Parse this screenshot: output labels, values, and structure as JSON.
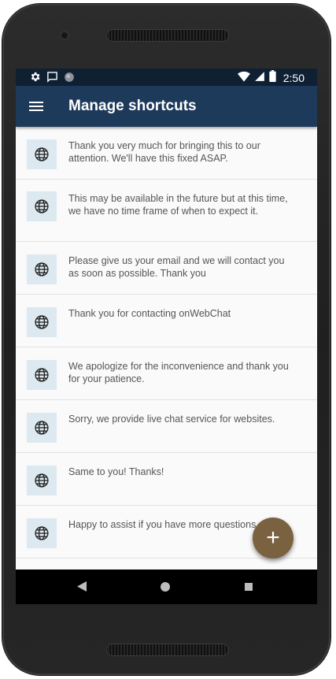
{
  "status_bar": {
    "time": "2:50",
    "left_icons": [
      "gear-icon",
      "message-icon",
      "circle-icon"
    ],
    "right_icons": [
      "wifi-icon",
      "signal-icon",
      "battery-icon"
    ]
  },
  "app_bar": {
    "menu_icon": "hamburger-menu-icon",
    "title": "Manage shortcuts"
  },
  "shortcuts": [
    {
      "text": "Thank you very much for bringing this to our attention. We'll have this fixed ASAP.",
      "icon": "globe-icon"
    },
    {
      "text": "This may be available in the future but at this time, we have no time frame of when to expect it.",
      "icon": "globe-icon"
    },
    {
      "text": "Please give us your email and we will contact you as soon as possible. Thank you",
      "icon": "globe-icon"
    },
    {
      "text": "Thank you for contacting onWebChat",
      "icon": "globe-icon"
    },
    {
      "text": "We apologize for the inconvenience and thank you for your patience.",
      "icon": "globe-icon"
    },
    {
      "text": "Sorry, we provide live chat service for websites.",
      "icon": "globe-icon"
    },
    {
      "text": "Same to you! Thanks!",
      "icon": "globe-icon"
    },
    {
      "text": "Happy to assist if you have more questions.",
      "icon": "globe-icon"
    }
  ],
  "fab": {
    "label": "+",
    "icon": "plus-icon"
  },
  "nav_bar": {
    "icons": [
      "back-icon",
      "home-icon",
      "recents-icon"
    ]
  },
  "colors": {
    "status_bar": "#0f2033",
    "app_bar": "#1e3a5b",
    "fab": "#7a6140",
    "icon_box": "#dde9f0"
  }
}
